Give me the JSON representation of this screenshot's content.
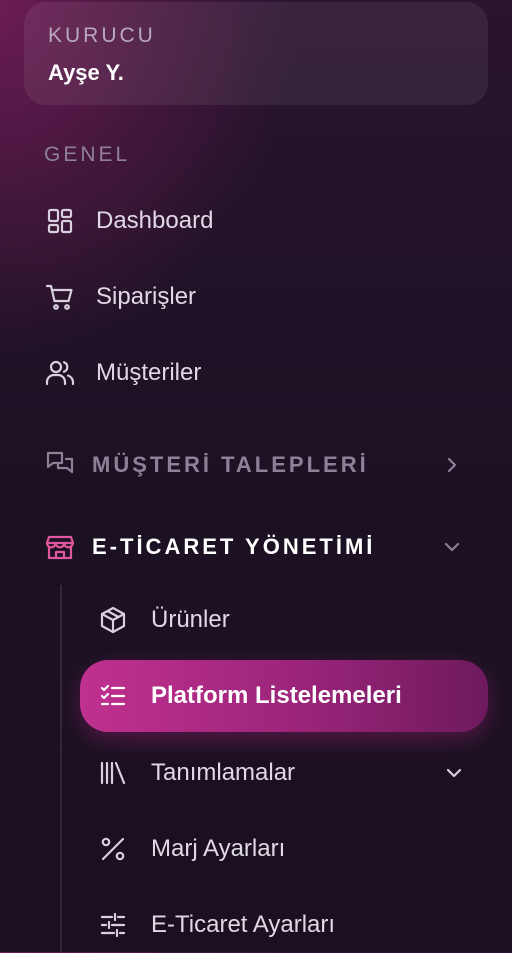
{
  "user": {
    "role": "KURUCU",
    "name": "Ayşe Y."
  },
  "sections": {
    "general": "GENEL"
  },
  "nav": [
    {
      "label": "Dashboard",
      "icon": "dashboard-grid-icon"
    },
    {
      "label": "Siparişler",
      "icon": "shopping-cart-icon"
    },
    {
      "label": "Müşteriler",
      "icon": "users-icon"
    }
  ],
  "groups": {
    "customer_requests": {
      "label": "MÜŞTERİ TALEPLERİ",
      "icon": "chat-bubbles-icon",
      "expanded": false
    },
    "ecommerce": {
      "label": "E-TİCARET YÖNETİMİ",
      "icon": "storefront-icon",
      "expanded": true
    }
  },
  "ecommerce_items": [
    {
      "label": "Ürünler",
      "icon": "box-icon"
    },
    {
      "label": "Platform Listelemeleri",
      "icon": "checklist-icon",
      "active": true
    },
    {
      "label": "Tanımlamalar",
      "icon": "library-icon",
      "has_submenu": true
    },
    {
      "label": "Marj Ayarları",
      "icon": "percent-icon"
    },
    {
      "label": "E-Ticaret Ayarları",
      "icon": "sliders-icon"
    }
  ],
  "colors": {
    "accent": "#c0318f",
    "accent_icon": "#e0569f",
    "muted": "#8f8097"
  }
}
